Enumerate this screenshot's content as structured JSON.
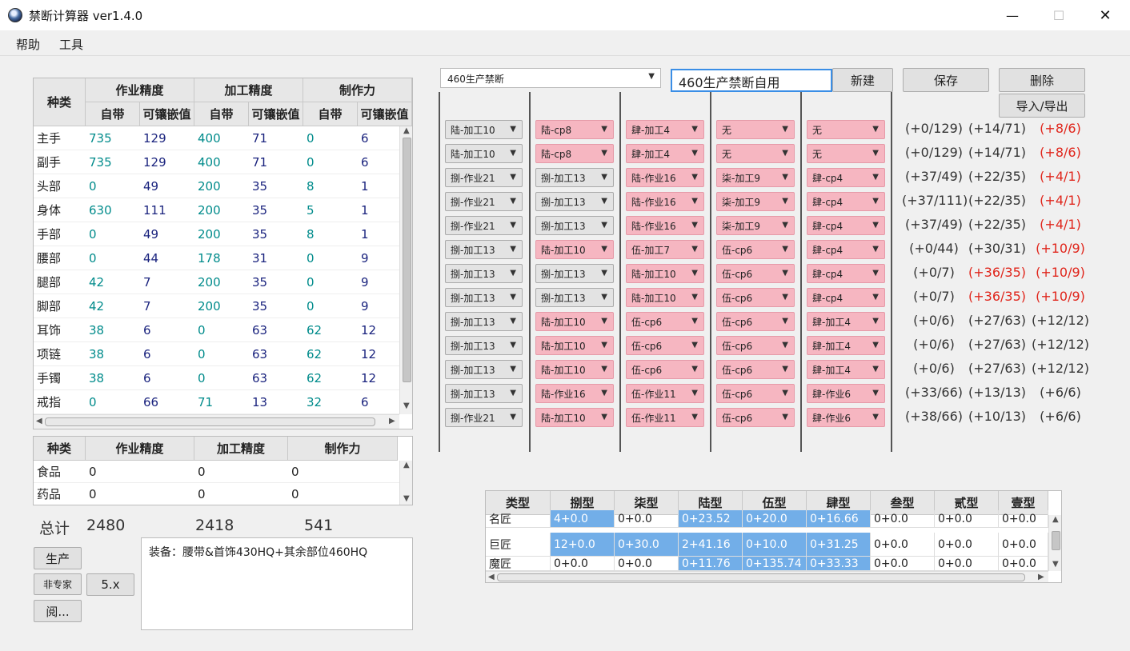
{
  "window": {
    "title": "禁断计算器 ver1.4.0",
    "min": "—",
    "max": "☐",
    "close": "✕"
  },
  "menu": {
    "help": "帮助",
    "tools": "工具"
  },
  "gear_table": {
    "col_type": "种类",
    "groups": [
      "作业精度",
      "加工精度",
      "制作力"
    ],
    "sub": [
      "自带",
      "可镶嵌值",
      "自带",
      "可镶嵌值",
      "自带",
      "可镶嵌值"
    ],
    "rows": [
      [
        "主手",
        "735",
        "129",
        "400",
        "71",
        "0",
        "6"
      ],
      [
        "副手",
        "735",
        "129",
        "400",
        "71",
        "0",
        "6"
      ],
      [
        "头部",
        "0",
        "49",
        "200",
        "35",
        "8",
        "1"
      ],
      [
        "身体",
        "630",
        "111",
        "200",
        "35",
        "5",
        "1"
      ],
      [
        "手部",
        "0",
        "49",
        "200",
        "35",
        "8",
        "1"
      ],
      [
        "腰部",
        "0",
        "44",
        "178",
        "31",
        "0",
        "9"
      ],
      [
        "腿部",
        "42",
        "7",
        "200",
        "35",
        "0",
        "9"
      ],
      [
        "脚部",
        "42",
        "7",
        "200",
        "35",
        "0",
        "9"
      ],
      [
        "耳饰",
        "38",
        "6",
        "0",
        "63",
        "62",
        "12"
      ],
      [
        "项链",
        "38",
        "6",
        "0",
        "63",
        "62",
        "12"
      ],
      [
        "手镯",
        "38",
        "6",
        "0",
        "63",
        "62",
        "12"
      ],
      [
        "戒指",
        "0",
        "66",
        "71",
        "13",
        "32",
        "6"
      ]
    ]
  },
  "food_table": {
    "headers": [
      "种类",
      "作业精度",
      "加工精度",
      "制作力"
    ],
    "rows": [
      [
        "食品",
        "0",
        "0",
        "0"
      ],
      [
        "药品",
        "0",
        "0",
        "0"
      ]
    ]
  },
  "totals": {
    "label": "总计",
    "craft": "2480",
    "control": "2418",
    "cp": "541"
  },
  "buttons": {
    "produce": "生产",
    "non_expert": "非专家",
    "version": "5.x",
    "read": "阅...",
    "new": "新建",
    "save": "保存",
    "delete": "删除",
    "import_export": "导入/导出"
  },
  "equip_note": "装备：腰带&首饰430HQ+其余部位460HQ",
  "preset": {
    "selected": "460生产禁断",
    "name_input": "460生产禁断自用"
  },
  "meld_rows": [
    {
      "cells": [
        [
          "陆-加工10",
          "gray"
        ],
        [
          "陆-cp8",
          "pink"
        ],
        [
          "肆-加工4",
          "pink"
        ],
        [
          "无",
          "pink"
        ],
        [
          "无",
          "pink"
        ]
      ],
      "res": [
        [
          "(+0/129)",
          ""
        ],
        [
          "(+14/71)",
          ""
        ],
        [
          "(+8/6)",
          "red"
        ]
      ]
    },
    {
      "cells": [
        [
          "陆-加工10",
          "gray"
        ],
        [
          "陆-cp8",
          "pink"
        ],
        [
          "肆-加工4",
          "pink"
        ],
        [
          "无",
          "pink"
        ],
        [
          "无",
          "pink"
        ]
      ],
      "res": [
        [
          "(+0/129)",
          ""
        ],
        [
          "(+14/71)",
          ""
        ],
        [
          "(+8/6)",
          "red"
        ]
      ]
    },
    {
      "cells": [
        [
          "捌-作业21",
          "gray"
        ],
        [
          "捌-加工13",
          "gray"
        ],
        [
          "陆-作业16",
          "pink"
        ],
        [
          "柒-加工9",
          "pink"
        ],
        [
          "肆-cp4",
          "pink"
        ]
      ],
      "res": [
        [
          "(+37/49)",
          ""
        ],
        [
          "(+22/35)",
          ""
        ],
        [
          "(+4/1)",
          "red"
        ]
      ]
    },
    {
      "cells": [
        [
          "捌-作业21",
          "gray"
        ],
        [
          "捌-加工13",
          "gray"
        ],
        [
          "陆-作业16",
          "pink"
        ],
        [
          "柒-加工9",
          "pink"
        ],
        [
          "肆-cp4",
          "pink"
        ]
      ],
      "res": [
        [
          "(+37/111)",
          ""
        ],
        [
          "(+22/35)",
          ""
        ],
        [
          "(+4/1)",
          "red"
        ]
      ]
    },
    {
      "cells": [
        [
          "捌-作业21",
          "gray"
        ],
        [
          "捌-加工13",
          "gray"
        ],
        [
          "陆-作业16",
          "pink"
        ],
        [
          "柒-加工9",
          "pink"
        ],
        [
          "肆-cp4",
          "pink"
        ]
      ],
      "res": [
        [
          "(+37/49)",
          ""
        ],
        [
          "(+22/35)",
          ""
        ],
        [
          "(+4/1)",
          "red"
        ]
      ]
    },
    {
      "cells": [
        [
          "捌-加工13",
          "gray"
        ],
        [
          "陆-加工10",
          "pink"
        ],
        [
          "伍-加工7",
          "pink"
        ],
        [
          "伍-cp6",
          "pink"
        ],
        [
          "肆-cp4",
          "pink"
        ]
      ],
      "res": [
        [
          "(+0/44)",
          ""
        ],
        [
          "(+30/31)",
          ""
        ],
        [
          "(+10/9)",
          "red"
        ]
      ]
    },
    {
      "cells": [
        [
          "捌-加工13",
          "gray"
        ],
        [
          "捌-加工13",
          "gray"
        ],
        [
          "陆-加工10",
          "pink"
        ],
        [
          "伍-cp6",
          "pink"
        ],
        [
          "肆-cp4",
          "pink"
        ]
      ],
      "res": [
        [
          "(+0/7)",
          ""
        ],
        [
          "(+36/35)",
          "red"
        ],
        [
          "(+10/9)",
          "red"
        ]
      ]
    },
    {
      "cells": [
        [
          "捌-加工13",
          "gray"
        ],
        [
          "捌-加工13",
          "gray"
        ],
        [
          "陆-加工10",
          "pink"
        ],
        [
          "伍-cp6",
          "pink"
        ],
        [
          "肆-cp4",
          "pink"
        ]
      ],
      "res": [
        [
          "(+0/7)",
          ""
        ],
        [
          "(+36/35)",
          "red"
        ],
        [
          "(+10/9)",
          "red"
        ]
      ]
    },
    {
      "cells": [
        [
          "捌-加工13",
          "gray"
        ],
        [
          "陆-加工10",
          "pink"
        ],
        [
          "伍-cp6",
          "pink"
        ],
        [
          "伍-cp6",
          "pink"
        ],
        [
          "肆-加工4",
          "pink"
        ]
      ],
      "res": [
        [
          "(+0/6)",
          ""
        ],
        [
          "(+27/63)",
          ""
        ],
        [
          "(+12/12)",
          ""
        ]
      ]
    },
    {
      "cells": [
        [
          "捌-加工13",
          "gray"
        ],
        [
          "陆-加工10",
          "pink"
        ],
        [
          "伍-cp6",
          "pink"
        ],
        [
          "伍-cp6",
          "pink"
        ],
        [
          "肆-加工4",
          "pink"
        ]
      ],
      "res": [
        [
          "(+0/6)",
          ""
        ],
        [
          "(+27/63)",
          ""
        ],
        [
          "(+12/12)",
          ""
        ]
      ]
    },
    {
      "cells": [
        [
          "捌-加工13",
          "gray"
        ],
        [
          "陆-加工10",
          "pink"
        ],
        [
          "伍-cp6",
          "pink"
        ],
        [
          "伍-cp6",
          "pink"
        ],
        [
          "肆-加工4",
          "pink"
        ]
      ],
      "res": [
        [
          "(+0/6)",
          ""
        ],
        [
          "(+27/63)",
          ""
        ],
        [
          "(+12/12)",
          ""
        ]
      ]
    },
    {
      "cells": [
        [
          "捌-加工13",
          "gray"
        ],
        [
          "陆-作业16",
          "pink"
        ],
        [
          "伍-作业11",
          "pink"
        ],
        [
          "伍-cp6",
          "pink"
        ],
        [
          "肆-作业6",
          "pink"
        ]
      ],
      "res": [
        [
          "(+33/66)",
          ""
        ],
        [
          "(+13/13)",
          ""
        ],
        [
          "(+6/6)",
          ""
        ]
      ]
    },
    {
      "cells": [
        [
          "捌-作业21",
          "gray"
        ],
        [
          "陆-加工10",
          "pink"
        ],
        [
          "伍-作业11",
          "pink"
        ],
        [
          "伍-cp6",
          "pink"
        ],
        [
          "肆-作业6",
          "pink"
        ]
      ],
      "res": [
        [
          "(+38/66)",
          ""
        ],
        [
          "(+10/13)",
          ""
        ],
        [
          "(+6/6)",
          ""
        ]
      ]
    }
  ],
  "type_table": {
    "headers": [
      "类型",
      "捌型",
      "柒型",
      "陆型",
      "伍型",
      "肆型",
      "叁型",
      "贰型",
      "壹型"
    ],
    "rows": [
      {
        "cells": [
          [
            "名匠",
            ""
          ],
          [
            "4+0.0",
            "blue"
          ],
          [
            "0+0.0",
            ""
          ],
          [
            "0+23.52",
            "blue"
          ],
          [
            "0+20.0",
            "blue"
          ],
          [
            "0+16.66",
            "blue"
          ],
          [
            "0+0.0",
            ""
          ],
          [
            "0+0.0",
            ""
          ],
          [
            "0+0.0",
            ""
          ]
        ]
      },
      {
        "cells": [
          [
            "巨匠",
            ""
          ],
          [
            "12+0.0",
            "blue"
          ],
          [
            "0+30.0",
            "blue"
          ],
          [
            "2+41.16",
            "blue"
          ],
          [
            "0+10.0",
            "blue"
          ],
          [
            "0+31.25",
            "blue"
          ],
          [
            "0+0.0",
            ""
          ],
          [
            "0+0.0",
            ""
          ],
          [
            "0+0.0",
            ""
          ]
        ]
      },
      {
        "cells": [
          [
            "魔匠",
            ""
          ],
          [
            "0+0.0",
            ""
          ],
          [
            "0+0.0",
            ""
          ],
          [
            "0+11.76",
            "blue"
          ],
          [
            "0+135.74",
            "blue"
          ],
          [
            "0+33.33",
            "blue"
          ],
          [
            "0+0.0",
            ""
          ],
          [
            "0+0.0",
            ""
          ],
          [
            "0+0.0",
            ""
          ]
        ]
      }
    ]
  },
  "colors": {
    "teal": "#008b8b",
    "navy": "#1a237e",
    "pink": "#f6b6c1",
    "red": "#e0251b",
    "blue": "#72aee8"
  }
}
